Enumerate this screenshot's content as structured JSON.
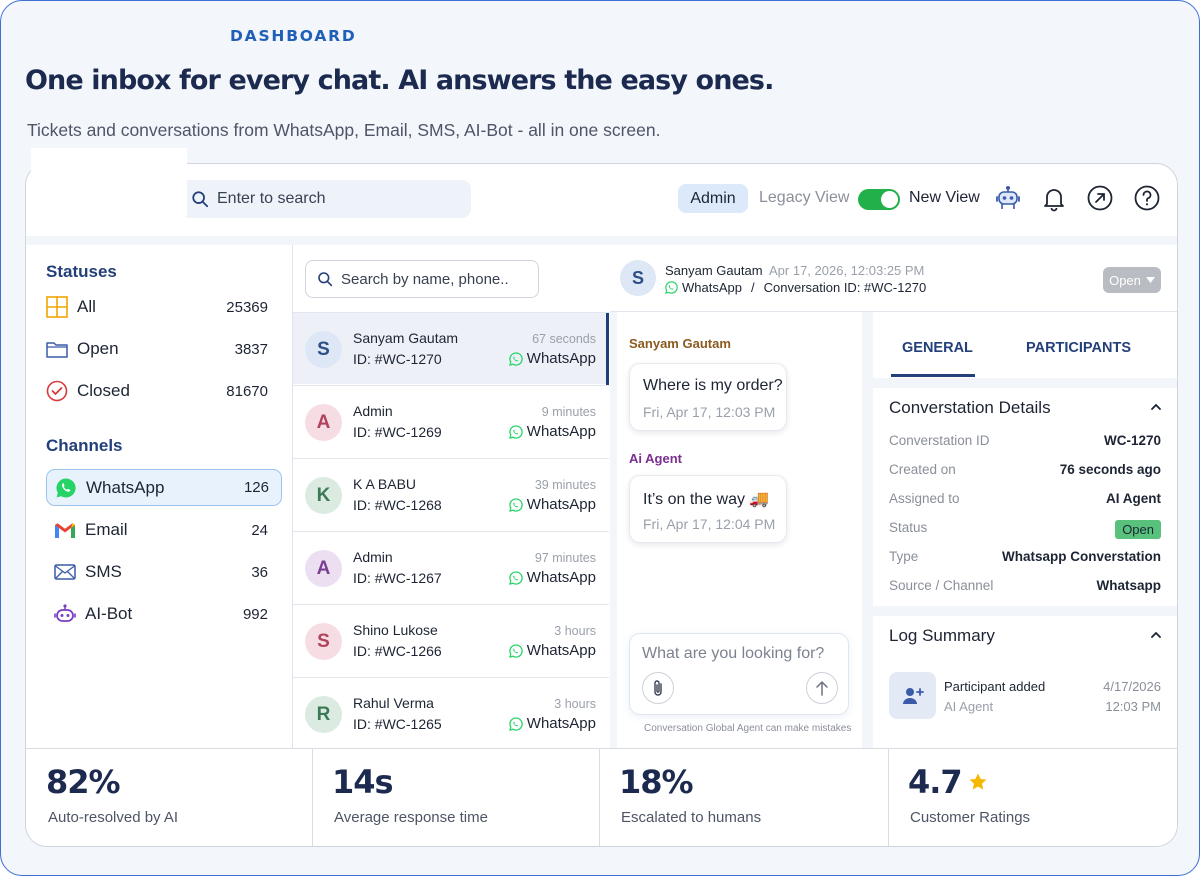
{
  "page": {
    "eyebrow": "DASHBOARD",
    "headline": "One inbox for every chat. AI answers the easy ones.",
    "subline": "Tickets and conversations from WhatsApp, Email, SMS, AI-Bot - all in one screen."
  },
  "topbar": {
    "search_placeholder": "Enter to search",
    "role": "Admin",
    "legacy_view": "Legacy View",
    "new_view": "New View",
    "toggle_on": true,
    "icons": [
      "robot-icon",
      "bell-icon",
      "external-link-icon",
      "help-icon"
    ]
  },
  "sidebar": {
    "statuses_title": "Statuses",
    "statuses": [
      {
        "label": "All",
        "count": "25369",
        "icon": "grid-icon"
      },
      {
        "label": "Open",
        "count": "3837",
        "icon": "folder-icon"
      },
      {
        "label": "Closed",
        "count": "81670",
        "icon": "check-circle-icon"
      }
    ],
    "channels_title": "Channels",
    "channels": [
      {
        "label": "WhatsApp",
        "count": "126",
        "icon": "whatsapp-icon",
        "active": true
      },
      {
        "label": "Email",
        "count": "24",
        "icon": "gmail-icon"
      },
      {
        "label": "SMS",
        "count": "36",
        "icon": "mail-icon"
      },
      {
        "label": "AI-Bot",
        "count": "992",
        "icon": "bot-icon"
      }
    ]
  },
  "conversations": {
    "search_placeholder": "Search by name, phone..",
    "items": [
      {
        "initial": "S",
        "name": "Sanyam Gautam",
        "id": "ID: #WC-1270",
        "time": "67 seconds",
        "channel": "WhatsApp",
        "avatar_bg": "#dde7f5",
        "avatar_fg": "#2c4f86"
      },
      {
        "initial": "A",
        "name": "Admin",
        "id": "ID: #WC-1269",
        "time": "9 minutes",
        "channel": "WhatsApp",
        "avatar_bg": "#f6dde3",
        "avatar_fg": "#b0425c"
      },
      {
        "initial": "K",
        "name": "K A BABU",
        "id": "ID: #WC-1268",
        "time": "39 minutes",
        "channel": "WhatsApp",
        "avatar_bg": "#dcebe2",
        "avatar_fg": "#3b7a55"
      },
      {
        "initial": "A",
        "name": "Admin",
        "id": "ID: #WC-1267",
        "time": "97 minutes",
        "channel": "WhatsApp",
        "avatar_bg": "#ecdff2",
        "avatar_fg": "#7b3f93"
      },
      {
        "initial": "S",
        "name": "Shino Lukose",
        "id": "ID: #WC-1266",
        "time": "3 hours",
        "channel": "WhatsApp",
        "avatar_bg": "#f6dde3",
        "avatar_fg": "#b0425c"
      },
      {
        "initial": "R",
        "name": "Rahul Verma",
        "id": "ID: #WC-1265",
        "time": "3 hours",
        "channel": "WhatsApp",
        "avatar_bg": "#dcebe2",
        "avatar_fg": "#3b7a55"
      }
    ]
  },
  "chat": {
    "header": {
      "initial": "S",
      "name": "Sanyam Gautam",
      "datetime": "Apr 17, 2026, 12:03:25 PM",
      "channel": "WhatsApp",
      "separator": "/",
      "conversation": "Conversation ID: #WC-1270",
      "status": "Open"
    },
    "messages": [
      {
        "sender": "Sanyam Gautam",
        "sender_color": "#8a5a1e",
        "text": "Where is my order?",
        "time": "Fri, Apr 17, 12:03 PM"
      },
      {
        "sender": "Ai Agent",
        "sender_color": "#7b2f8f",
        "text": "It’s on the way 🚚",
        "time": "Fri, Apr 17, 12:04 PM"
      }
    ],
    "composer_placeholder": "What are you looking for?",
    "disclaimer": "Conversation Global Agent can make mistakes"
  },
  "details": {
    "tabs": [
      "GENERAL",
      "PARTICIPANTS"
    ],
    "active_tab": "GENERAL",
    "section_title": "Converstation Details",
    "rows": [
      {
        "key": "Converstation ID",
        "value": "WC-1270"
      },
      {
        "key": "Created on",
        "value": "76 seconds ago"
      },
      {
        "key": "Assigned to",
        "value": "AI Agent"
      },
      {
        "key": "Status",
        "value": "Open"
      },
      {
        "key": "Type",
        "value": "Whatsapp Converstation"
      },
      {
        "key": "Source / Channel",
        "value": "Whatsapp"
      }
    ],
    "log_title": "Log Summary",
    "log": {
      "title": "Participant added",
      "subtitle": "AI Agent",
      "date": "4/17/2026",
      "time": "12:03 PM"
    }
  },
  "stats": [
    {
      "value": "82%",
      "label": "Auto-resolved by AI"
    },
    {
      "value": "14s",
      "label": "Average response time"
    },
    {
      "value": "18%",
      "label": "Escalated to humans"
    },
    {
      "value": "4.7",
      "label": "Customer Ratings",
      "star": true
    }
  ],
  "colors": {
    "accent": "#1f5fb8",
    "navy": "#1b2a4e",
    "whatsapp": "#25d366",
    "toggle": "#22b04b",
    "open_badge": "#58c27d"
  }
}
